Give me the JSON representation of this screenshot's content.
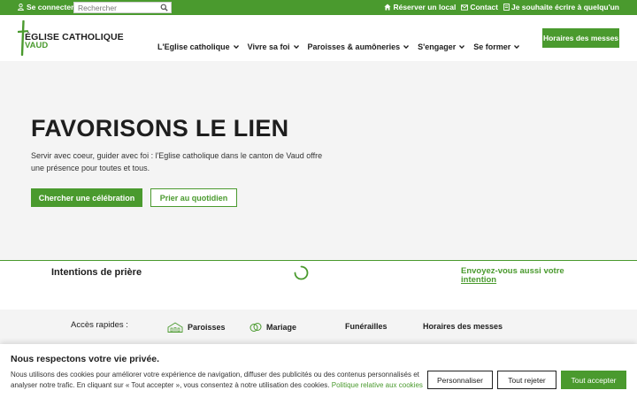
{
  "colors": {
    "brand_green": "#4a9a2e",
    "dark_text": "#1e1e1e",
    "page_bg": "#f4f4f4"
  },
  "topbar": {
    "login_label": "Se connecter",
    "login_icon": "user-icon",
    "search_placeholder": "Rechercher",
    "search_icon": "search-icon",
    "links": [
      {
        "label": "Réserver un local",
        "icon": "home-icon"
      },
      {
        "label": "Contact",
        "icon": "envelope-icon"
      },
      {
        "label": "Je souhaite écrire à quelqu'un",
        "icon": "document-icon"
      }
    ]
  },
  "header": {
    "logo_line1": "ÉGLISE CATHOLIQUE",
    "logo_line2": "VAUD",
    "nav": [
      {
        "label": "L'Eglise catholique"
      },
      {
        "label": "Vivre sa foi"
      },
      {
        "label": "Paroisses & aumôneries"
      },
      {
        "label": "S'engager"
      },
      {
        "label": "Se former"
      }
    ],
    "cta_label": "Horaires des messes"
  },
  "hero": {
    "title": "FAVORISONS LE LIEN",
    "subtitle": "Servir avec coeur, guider avec foi : l'Eglise catholique dans le canton de Vaud offre une présence pour toutes et tous.",
    "primary_button": "Chercher une célébration",
    "secondary_button": "Prier au quotidien"
  },
  "intentions": {
    "title": "Intentions de prière",
    "link_line1": "Envoyez-vous aussi votre",
    "link_line2": "intention"
  },
  "quick_access": {
    "label": "Accès rapides :",
    "items": [
      {
        "label": "Paroisses",
        "icon": "church-icon"
      },
      {
        "label": "Mariage",
        "icon": "rings-icon"
      },
      {
        "label": "Funérailles"
      },
      {
        "label": "Horaires des messes"
      }
    ]
  },
  "cookie": {
    "title": "Nous respectons votre vie privée.",
    "text": "Nous utilisons des cookies pour améliorer votre expérience de navigation, diffuser des publicités ou des contenus personnalisés et analyser notre trafic. En cliquant sur « Tout accepter », vous consentez à notre utilisation des cookies.",
    "policy_link": "Politique relative aux cookies",
    "customize_label": "Personnaliser",
    "reject_label": "Tout rejeter",
    "accept_label": "Tout accepter"
  }
}
